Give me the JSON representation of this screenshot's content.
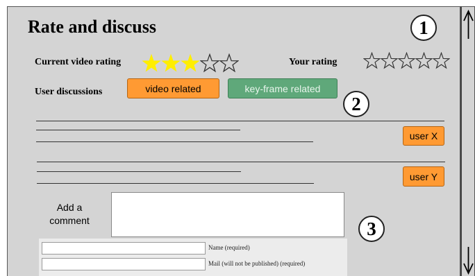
{
  "title": "Rate and discuss",
  "current_rating": {
    "label": "Current video rating",
    "value": 3,
    "max": 5
  },
  "your_rating": {
    "label": "Your rating",
    "value": 0,
    "max": 5
  },
  "discussions": {
    "label": "User discussions",
    "tabs": [
      {
        "label": "video related",
        "active": true
      },
      {
        "label": "key-frame related",
        "active": false
      }
    ]
  },
  "comments": [
    {
      "user": "user X"
    },
    {
      "user": "user Y"
    }
  ],
  "add_comment": {
    "label": "Add a comment",
    "value": ""
  },
  "form": {
    "name_label": "Name (required)",
    "mail_label": "Mail (will not be published) (required)"
  },
  "callouts": [
    "1",
    "2",
    "3"
  ],
  "colors": {
    "accent_orange": "#ff9a33",
    "accent_green": "#5fa87a",
    "star_filled": "#ffee00",
    "panel_bg": "#d4d4d4"
  }
}
